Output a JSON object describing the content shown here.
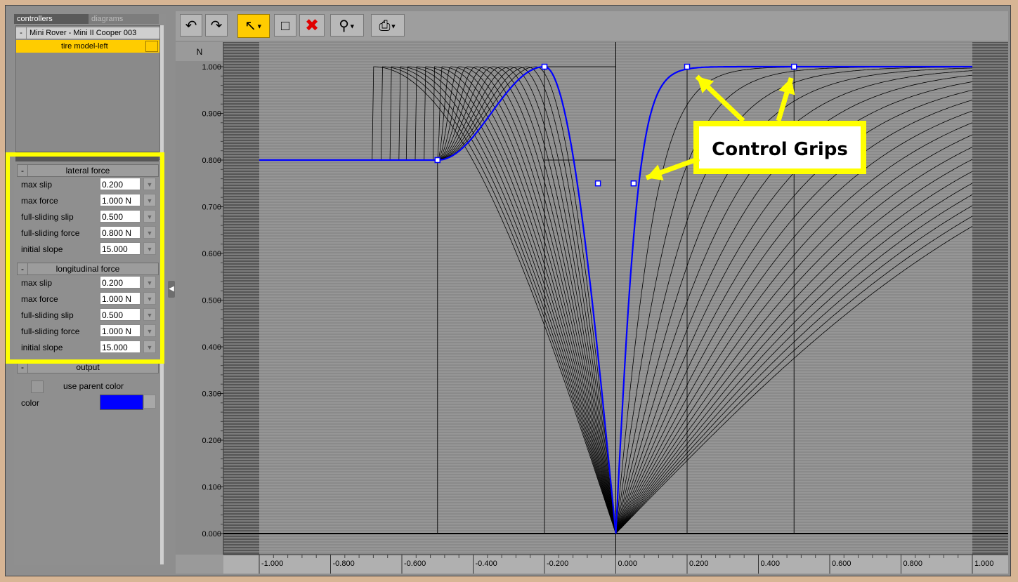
{
  "left_panel": {
    "tabs": [
      "controllers",
      "diagrams"
    ],
    "tree": {
      "root_label": "Mini Rover - Mini II Cooper 003",
      "selected_label": "tire model-left"
    },
    "lateral": {
      "title": "lateral force",
      "rows": [
        {
          "label": "max slip",
          "value": "0.200"
        },
        {
          "label": "max force",
          "value": "1.000 N"
        },
        {
          "label": "full-sliding slip",
          "value": "0.500"
        },
        {
          "label": "full-sliding force",
          "value": "0.800 N"
        },
        {
          "label": "initial slope",
          "value": "15.000"
        }
      ]
    },
    "longitudinal": {
      "title": "longitudinal force",
      "rows": [
        {
          "label": "max slip",
          "value": "0.200"
        },
        {
          "label": "max force",
          "value": "1.000 N"
        },
        {
          "label": "full-sliding slip",
          "value": "0.500"
        },
        {
          "label": "full-sliding force",
          "value": "1.000 N"
        },
        {
          "label": "initial slope",
          "value": "15.000"
        }
      ]
    },
    "output": {
      "title": "output",
      "use_parent_label": "use parent color",
      "color_label": "color",
      "color_value": "#0000ff"
    },
    "minus_symbol": "-"
  },
  "toolbar": {
    "icons": [
      "undo-icon",
      "redo-icon",
      "select-arrow-icon",
      "box-select-icon",
      "delete-icon",
      "zoom-icon",
      "print-icon"
    ],
    "active_color": "#ffcc00"
  },
  "chart_data": {
    "type": "line",
    "ylabel": "N",
    "xlim": [
      -1.0,
      1.0
    ],
    "ylim": [
      0.0,
      1.0
    ],
    "xticks": [
      "-1.000",
      "-0.800",
      "-0.600",
      "-0.400",
      "-0.200",
      "0.000",
      "0.200",
      "0.400",
      "0.600",
      "0.800",
      "1.000"
    ],
    "yticks": [
      "0.000",
      "0.100",
      "0.200",
      "0.300",
      "0.400",
      "0.500",
      "0.600",
      "0.700",
      "0.800",
      "0.900",
      "1.000"
    ],
    "series_color": "#0000ff",
    "lateral": {
      "max_slip": 0.2,
      "max_force": 1.0,
      "full_sliding_slip": 0.5,
      "full_sliding_force": 0.8,
      "initial_slope": 15.0
    },
    "longitudinal": {
      "max_slip": 0.2,
      "max_force": 1.0,
      "full_sliding_slip": 0.5,
      "full_sliding_force": 1.0,
      "initial_slope": 15.0
    },
    "guides_x": [
      -0.5,
      -0.2,
      0.2,
      0.5
    ],
    "guides_y": [
      1.0,
      0.8
    ],
    "grips": [
      {
        "x": -0.5,
        "y": 0.8
      },
      {
        "x": -0.2,
        "y": 1.0
      },
      {
        "x": -0.05,
        "y": 0.75
      },
      {
        "x": 0.05,
        "y": 0.75
      },
      {
        "x": 0.2,
        "y": 1.0
      },
      {
        "x": 0.5,
        "y": 1.0
      }
    ],
    "annotation": "Control Grips"
  }
}
